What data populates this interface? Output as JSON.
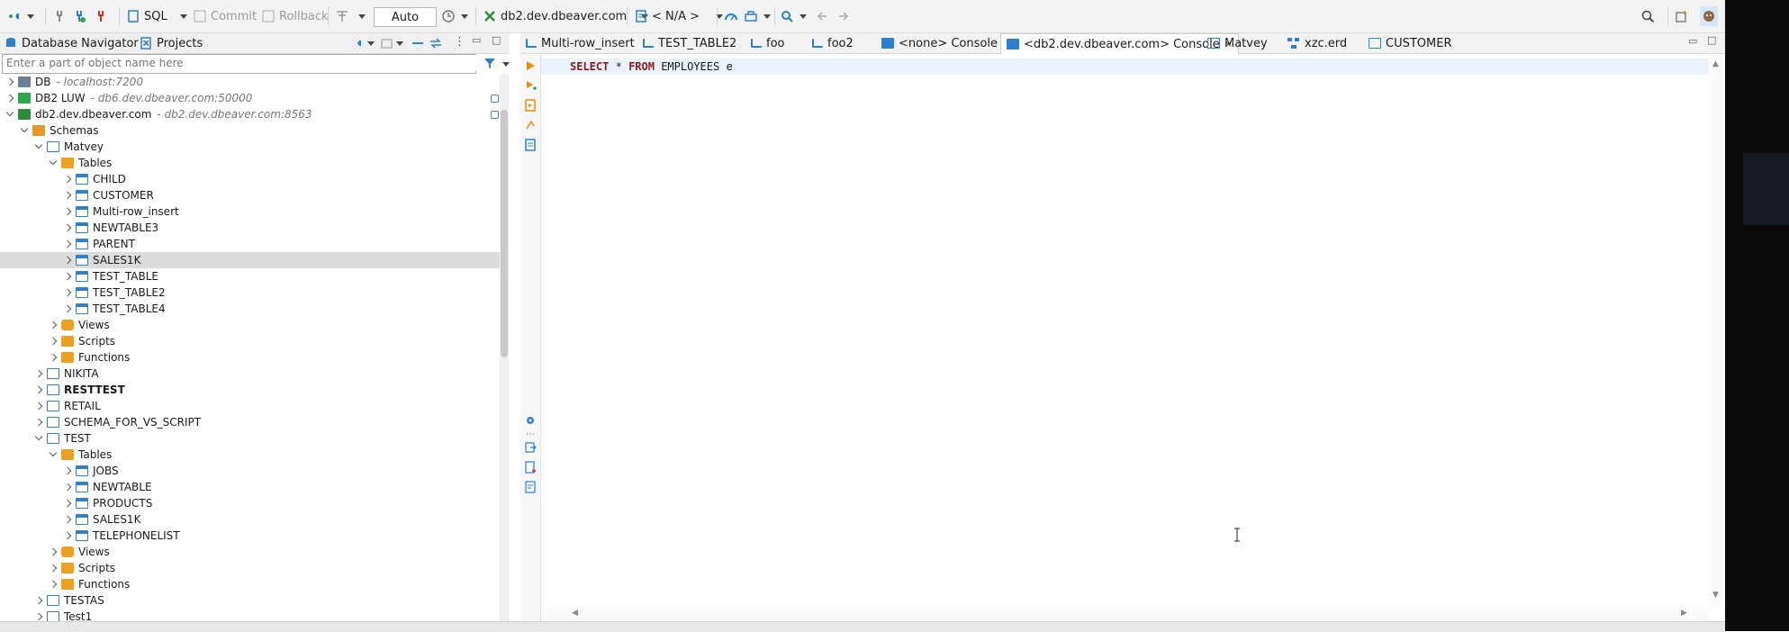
{
  "toolbar": {
    "sql_label": "SQL",
    "commit_label": "Commit",
    "rollback_label": "Rollback",
    "transaction_mode": "Auto",
    "connection_label": "db2.dev.dbeaver.com",
    "schema_label": "< N/A >"
  },
  "left_panel": {
    "tab_navigator": "Database Navigator",
    "tab_projects": "Projects",
    "filter_placeholder": "Enter a part of object name here"
  },
  "tree": {
    "db": {
      "label": "DB",
      "host": "- localhost:7200"
    },
    "db2luw": {
      "label": "DB2 LUW",
      "host": "- db6.dev.dbeaver.com:50000"
    },
    "db2dev": {
      "label": "db2.dev.dbeaver.com",
      "host": "- db2.dev.dbeaver.com:8563"
    },
    "schemas": "Schemas",
    "matvey": "Matvey",
    "tables": "Tables",
    "t_child": "CHILD",
    "t_customer": "CUSTOMER",
    "t_multirow": "Multi-row_insert",
    "t_newtable3": "NEWTABLE3",
    "t_parent": "PARENT",
    "t_sales1k": "SALES1K",
    "t_test_table": "TEST_TABLE",
    "t_test_table2": "TEST_TABLE2",
    "t_test_table4": "TEST_TABLE4",
    "views": "Views",
    "scripts": "Scripts",
    "functions": "Functions",
    "nikita": "NIKITA",
    "resttest": "RESTTEST",
    "retail": "RETAIL",
    "schema_vs": "SCHEMA_FOR_VS_SCRIPT",
    "test": "TEST",
    "test_tables": "Tables",
    "tt_jobs": "JOBS",
    "tt_newtable": "NEWTABLE",
    "tt_products": "PRODUCTS",
    "tt_sales1k": "SALES1K",
    "tt_telephonelist": "TELEPHONELIST",
    "test_views": "Views",
    "test_scripts": "Scripts",
    "test_functions": "Functions",
    "testas": "TESTAS",
    "test1": "Test1"
  },
  "editor_tabs": [
    "Multi-row_insert",
    "TEST_TABLE2",
    "foo",
    "foo2",
    "<none> Console",
    "<db2.dev.dbeaver.com> Console",
    "Matvey",
    "xzc.erd",
    "CUSTOMER"
  ],
  "editor": {
    "kw_select": "SELECT",
    "star": "*",
    "kw_from": "FROM",
    "table": "EMPLOYEES",
    "alias": "e"
  },
  "colors": {
    "accent": "#2f7fd0",
    "keyword": "#8b1a1a",
    "selection": "#dcdcdc"
  }
}
